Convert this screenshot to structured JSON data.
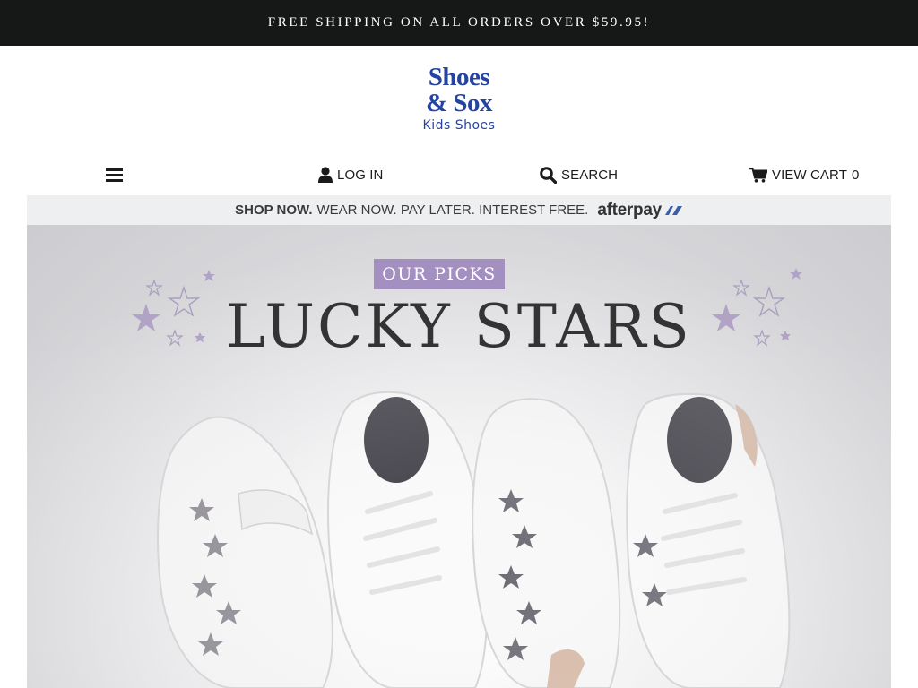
{
  "announcement": "FREE SHIPPING ON ALL ORDERS OVER $59.95!",
  "logo": {
    "line1": "Shoes",
    "line2": "& Sox",
    "line3": "Kids Shoes"
  },
  "nav": {
    "menu_icon": "hamburger-icon",
    "login": {
      "icon": "user-icon",
      "label": "LOG IN"
    },
    "search": {
      "icon": "search-icon",
      "label": "SEARCH"
    },
    "cart": {
      "icon": "cart-icon",
      "label": "VIEW CART",
      "count": "0"
    }
  },
  "afterpay": {
    "bold": "SHOP NOW.",
    "text": "WEAR NOW. PAY LATER. INTEREST FREE.",
    "logo_text": "afterpay"
  },
  "hero": {
    "badge": "OUR PICKS",
    "headline": "LUCKY STARS",
    "accent_color": "#a48fc1"
  },
  "colors": {
    "announcement_bg": "#161818",
    "logo_blue": "#2443a3",
    "afterpay_strip": "#eeeff1"
  }
}
